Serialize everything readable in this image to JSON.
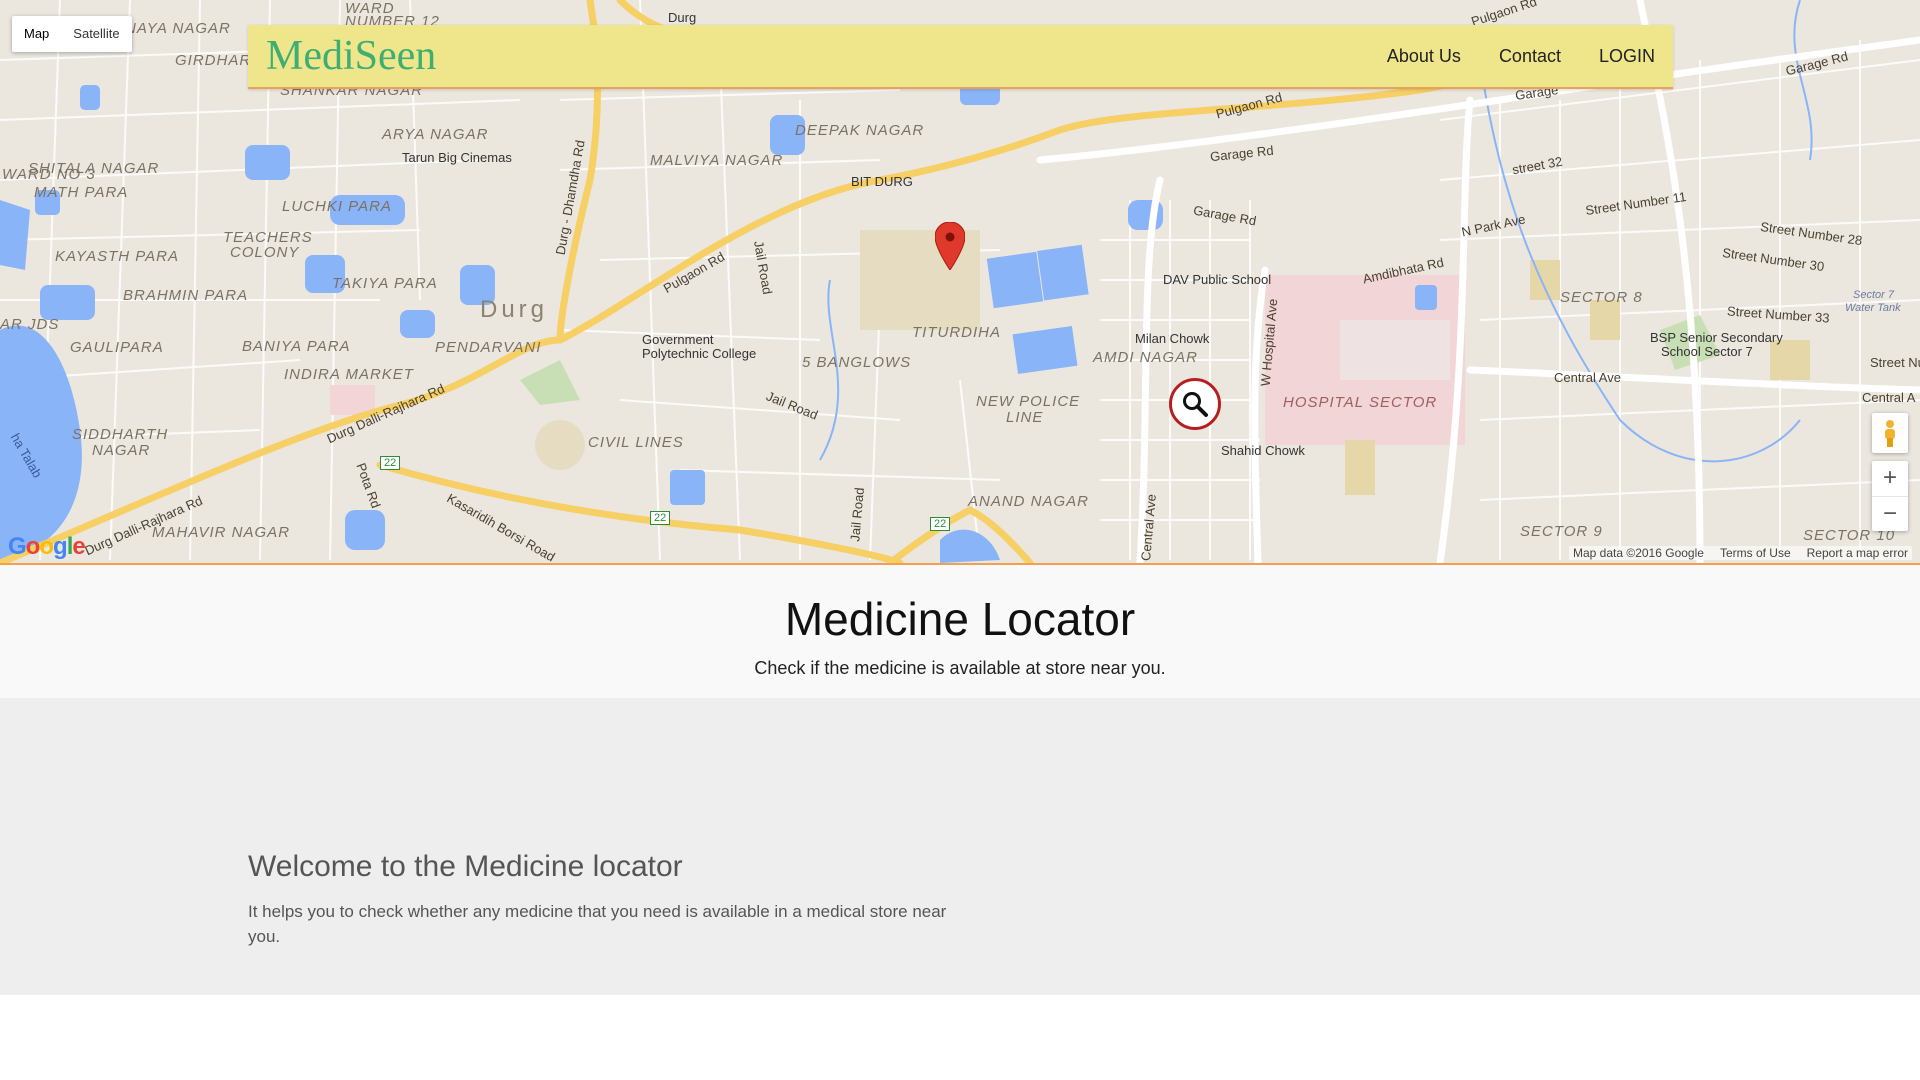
{
  "map": {
    "type_control": {
      "map": "Map",
      "satellite": "Satellite"
    },
    "labels": {
      "naya_nagar": "NAYA NAGAR",
      "ward_no": "WARD",
      "number_12": "NUMBER 12",
      "durg_station": "Durg",
      "girdhar": "GIRDHAR",
      "shankar_nagar": "SHANKAR NAGAR",
      "arya_nagar": "ARYA NAGAR",
      "tarun_cinemas": "Tarun Big Cinemas",
      "malviya_nagar": "MALVIYA NAGAR",
      "deepak_nagar": "DEEPAK NAGAR",
      "shitala_nagar": "SHITALA NAGAR",
      "ward_no_3": "WARD NO 3",
      "math_para": "MATH PARA",
      "luchki_para": "LUCHKI PARA",
      "teachers_colony_1": "TEACHERS",
      "teachers_colony_2": "COLONY",
      "kayasth_para": "KAYASTH PARA",
      "takiya_para": "TAKIYA PARA",
      "brahmin_para": "BRAHMIN PARA",
      "durg_big": "Durg",
      "gaulipara": "GAULIPARA",
      "baniya_para": "BANIYA PARA",
      "pendarvani": "PENDARVANI",
      "indira_market": "INDIRA MARKET",
      "siddharth_nagar_1": "SIDDHARTH",
      "siddharth_nagar_2": "NAGAR",
      "civil_lines": "CIVIL LINES",
      "mahavir_nagar": "MAHAVIR NAGAR",
      "bit_durg": "BIT DURG",
      "govt_poly_1": "Government",
      "govt_poly_2": "Polytechnic College",
      "titurdiha": "TITURDIHA",
      "five_banglows": "5 BANGLOWS",
      "amdi_nagar": "AMDI NAGAR",
      "new_police_line_1": "NEW POLICE",
      "new_police_line_2": "LINE",
      "anand_nagar": "ANAND NAGAR",
      "milan_chowk": "Milan Chowk",
      "dav_school": "DAV Public School",
      "shahid_chowk": "Shahid Chowk",
      "hospital_sector": "HOSPITAL SECTOR",
      "sector_8": "SECTOR 8",
      "sector_9": "SECTOR 9",
      "sector_10": "SECTOR 10",
      "sector_7_water_1": "Sector 7",
      "sector_7_water_2": "Water Tank",
      "bsp_school_1": "BSP Senior Secondary",
      "bsp_school_2": "School Sector 7",
      "pulgaon_rd": "Pulgaon Rd",
      "pulgaon_rd_2": "Pulgaon Rd",
      "pulgaon_rd_3": "Pulgaon Rd",
      "garage_rd_1": "Garage Rd",
      "garage_rd_2": "Garage Rd",
      "garage_rd_3": "Garage Rd",
      "garage_rd_4": "Garage",
      "durg_dhamdha_rd": "Durg - Dhamdha Rd",
      "jail_road_1": "Jail Road",
      "jail_road_2": "Jail Road",
      "jail_road_3": "Jail Road",
      "durg_dalli_rd_1": "Durg Dalli-Rajhara Rd",
      "durg_dalli_rd_2": "Durg Dalli-Rajhara Rd",
      "kasaridih_rd": "Kasaridih Borsi Road",
      "pota_rd": "Pota Rd",
      "central_ave_1": "Central Ave",
      "central_ave_2": "Central Ave",
      "central_ave_3": "Central A",
      "w_hospital_ave": "W Hospital Ave",
      "amdibhata_rd": "Amdibhata Rd",
      "n_park_ave": "N Park Ave",
      "street_32": "street 32",
      "street_11": "Street Number 11",
      "street_28": "Street Number 28",
      "street_30": "Street Number 30",
      "street_33": "Street Number 33",
      "street_nu": "Street Nu",
      "talab": "ha Talab",
      "ar_jds": "AR JDS",
      "hwy_22": "22"
    },
    "footer": {
      "map_data": "Map data ©2016 Google",
      "terms": "Terms of Use",
      "report": "Report a map error"
    },
    "logo": [
      "G",
      "o",
      "o",
      "g",
      "l",
      "e"
    ],
    "zoom": {
      "in": "+",
      "out": "−"
    }
  },
  "navbar": {
    "brand": "MediSeen",
    "links": {
      "about": "About Us",
      "contact": "Contact",
      "login": "LOGIN"
    }
  },
  "header": {
    "title": "Medicine Locator",
    "subtitle": "Check if the medicine is available at store near you."
  },
  "welcome": {
    "heading": "Welcome to the Medicine locator",
    "text": "It helps you to check whether any medicine that you need is available in a medical store near you."
  },
  "colors": {
    "brand_green": "#3fae72",
    "navbar_bg": "#efe68b",
    "navbar_border": "#e3a35a",
    "map_bg": "#ebe7df",
    "water": "#8ab4f8",
    "highway": "#f6cf65",
    "marker_red": "#e0392b"
  }
}
